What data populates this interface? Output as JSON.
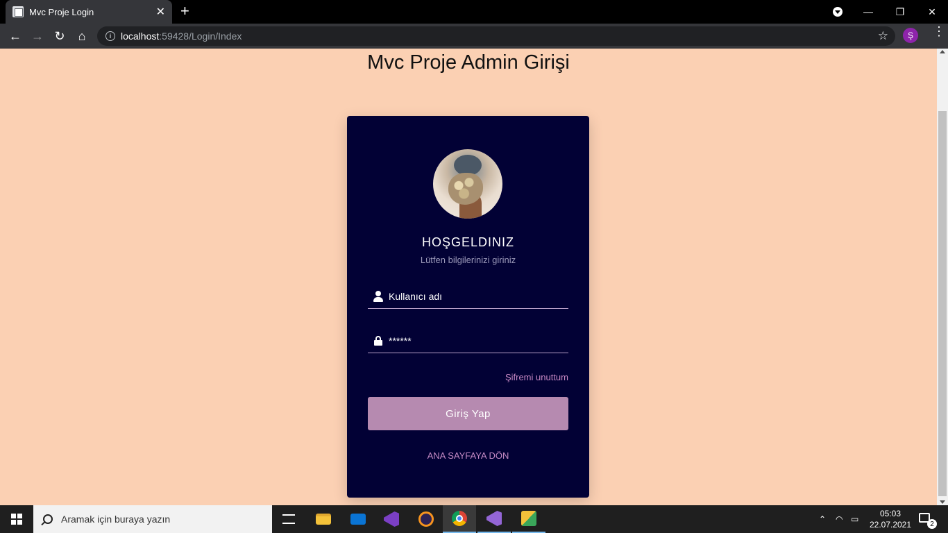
{
  "browser": {
    "tab_title": "Mvc Proje Login",
    "tab_close": "✕",
    "new_tab": "+",
    "url_host": "localhost",
    "url_path": ":59428/Login/Index",
    "profile_initial": "Ş",
    "window_controls": {
      "minimize": "—",
      "restore": "❐",
      "close": "✕"
    }
  },
  "page": {
    "title": "Mvc Proje Admin Girişi"
  },
  "login_card": {
    "welcome": "HOŞGELDINIZ",
    "subtitle": "Lütfen bilgilerinizi giriniz",
    "username_value": "Kullanıcı adı",
    "password_value": "******",
    "forgot_password": "Şifremi unuttum",
    "submit_label": "Giriş Yap",
    "home_link": "ANA SAYFAYA DÖN",
    "colors": {
      "card_bg": "#020135",
      "button_bg": "#b68ab0",
      "link": "#c889c4",
      "page_bg": "#fbd0b3"
    }
  },
  "taskbar": {
    "search_placeholder": "Aramak için buraya yazın",
    "time": "05:03",
    "date": "22.07.2021",
    "notification_count": "2",
    "apps": [
      "task-view-icon",
      "file-explorer-icon",
      "mail-icon",
      "visual-studio-icon",
      "eclipse-icon",
      "chrome-icon",
      "visual-studio-2-icon",
      "app-icon"
    ]
  }
}
